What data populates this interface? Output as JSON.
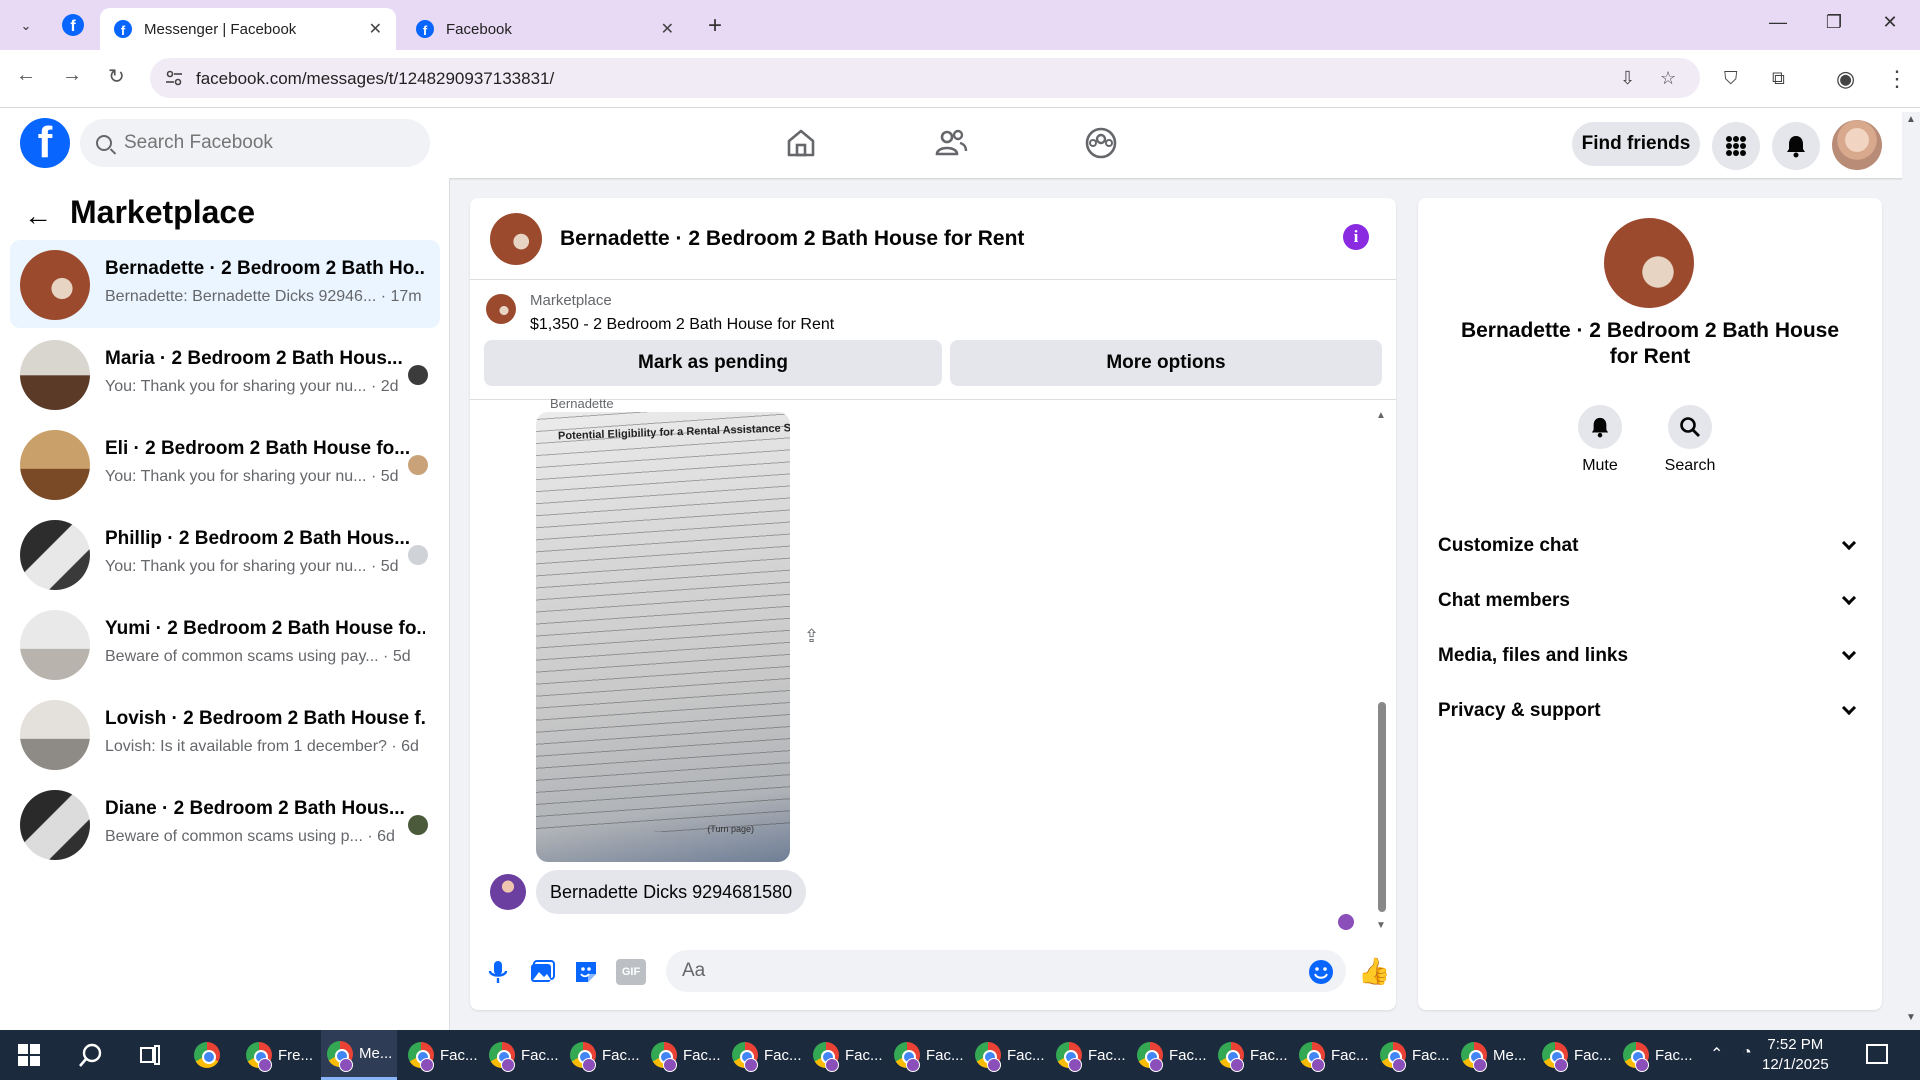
{
  "browser": {
    "tabs": [
      {
        "title": "Messenger | Facebook",
        "active": true
      },
      {
        "title": "Facebook",
        "active": false
      }
    ],
    "url": "facebook.com/messages/t/1248290937133831/"
  },
  "fb_header": {
    "search_placeholder": "Search Facebook",
    "find_friends_label": "Find friends"
  },
  "sidebar": {
    "title": "Marketplace",
    "conversations": [
      {
        "name": "Bernadette · 2 Bedroom 2 Bath Ho...",
        "snippet": "Bernadette: Bernadette Dicks 92946... · 17m",
        "active": true
      },
      {
        "name": "Maria · 2 Bedroom 2 Bath Hous...",
        "snippet": "You: Thank you for sharing your nu... · 2d"
      },
      {
        "name": "Eli · 2 Bedroom 2 Bath House fo...",
        "snippet": "You: Thank you for sharing your nu... · 5d"
      },
      {
        "name": "Phillip · 2 Bedroom 2 Bath Hous...",
        "snippet": "You: Thank you for sharing your nu... · 5d"
      },
      {
        "name": "Yumi · 2 Bedroom 2 Bath House fo...",
        "snippet": "Beware of common scams using pay... · 5d"
      },
      {
        "name": "Lovish · 2 Bedroom 2 Bath House f...",
        "snippet": "Lovish: Is it available from 1 december? · 6d"
      },
      {
        "name": "Diane · 2 Bedroom 2 Bath Hous...",
        "snippet": "Beware of common scams using p... · 6d"
      }
    ]
  },
  "chat": {
    "title": "Bernadette · 2 Bedroom 2 Bath House for Rent",
    "marketplace_label": "Marketplace",
    "listing": "$1,350 - 2 Bedroom 2 Bath House for Rent",
    "mark_pending_label": "Mark as pending",
    "more_options_label": "More options",
    "sender_name": "Bernadette",
    "document_heading": "Potential Eligibility for a Rental Assistance Supp",
    "document_footer": "(Turn page)",
    "message_text": "Bernadette Dicks 9294681580",
    "composer_placeholder": "Aa"
  },
  "details": {
    "title": "Bernadette · 2 Bedroom 2 Bath House for Rent",
    "mute_label": "Mute",
    "search_label": "Search",
    "sections": [
      "Customize chat",
      "Chat members",
      "Media, files and links",
      "Privacy & support"
    ]
  },
  "taskbar": {
    "items": [
      "Fre...",
      "Me...",
      "Fac...",
      "Fac...",
      "Fac...",
      "Fac...",
      "Fac...",
      "Fac...",
      "Fac...",
      "Fac...",
      "Fac...",
      "Fac...",
      "Fac...",
      "Fac...",
      "Fac...",
      "Me...",
      "Fac...",
      "Fac..."
    ],
    "active_index": 1,
    "time": "7:52 PM",
    "date": "12/1/2025"
  },
  "colors": {
    "fb_blue": "#0866ff",
    "messenger_purple": "#8a2be2",
    "active_conversation_bg": "#ebf5ff"
  }
}
